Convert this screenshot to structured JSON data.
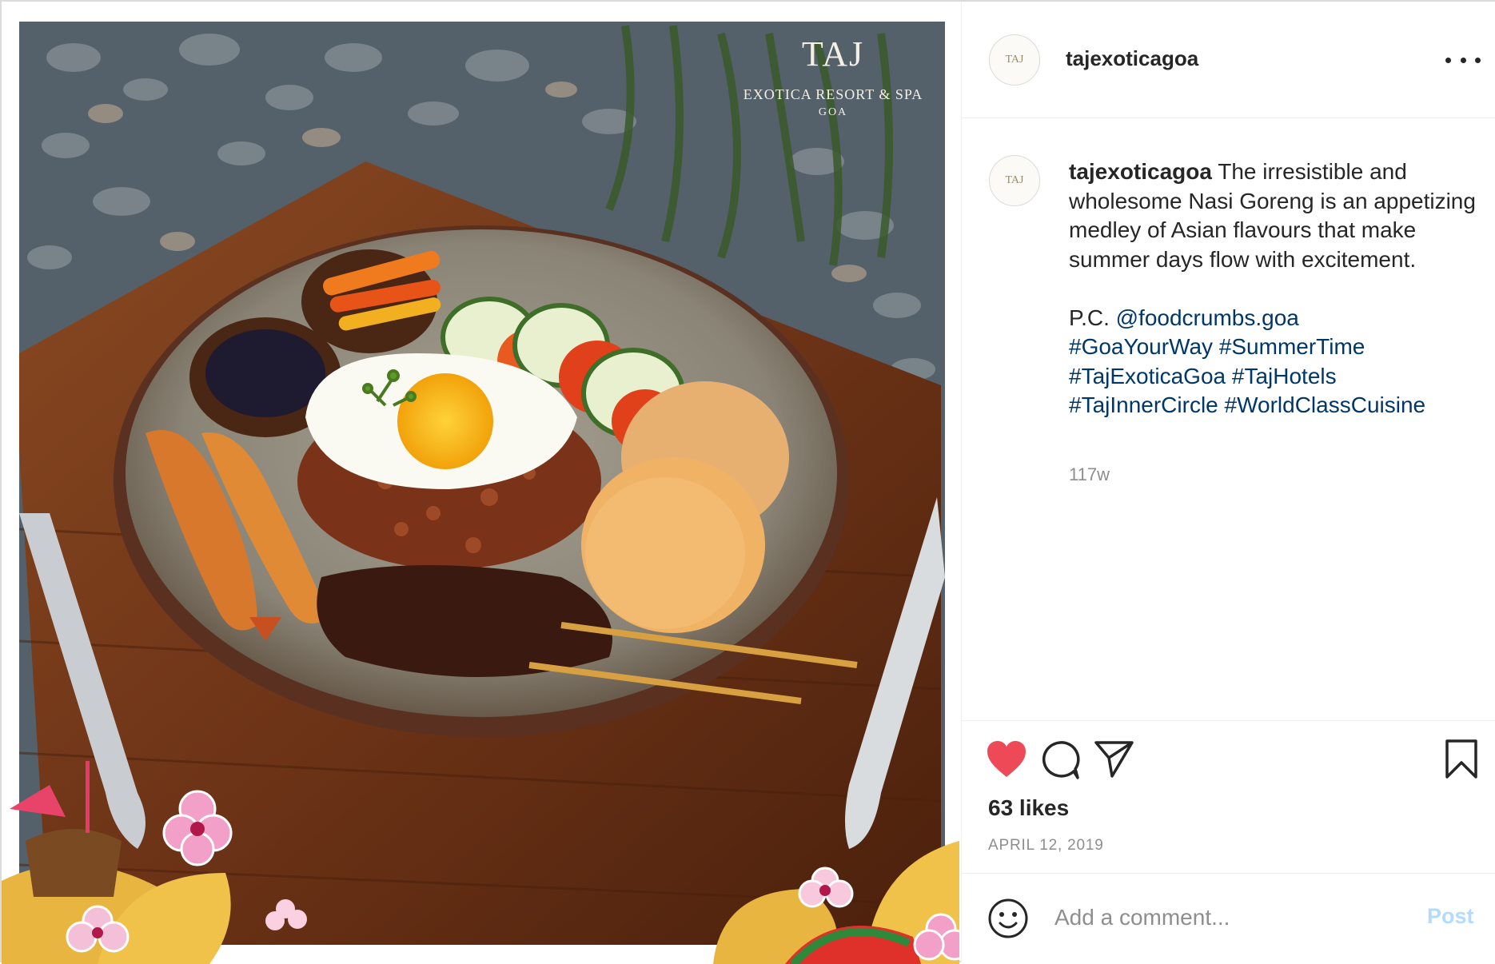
{
  "photo": {
    "logo_name": "TAJ",
    "logo_line": "EXOTICA RESORT & SPA",
    "logo_city": "GOA",
    "logo_alt": "Taj Exotica Resort & Spa Goa"
  },
  "header": {
    "username": "tajexoticagoa",
    "avatar_text": "TAJ"
  },
  "caption": {
    "username": "tajexoticagoa",
    "text": "The irresistible and wholesome Nasi Goreng is an appetizing medley of Asian flavours that make summer days flow with excitement.",
    "credit_prefix": "P.C. ",
    "mention": "@foodcrumbs.goa",
    "hashtags": [
      "#GoaYourWay",
      "#SummerTime",
      "#TajExoticaGoa",
      "#TajHotels",
      "#TajInnerCircle",
      "#WorldClassCuisine"
    ],
    "age": "117w"
  },
  "actions": {
    "likes": "63 likes",
    "date": "APRIL 12, 2019",
    "like_color": "#ed4956",
    "liked": true
  },
  "comment": {
    "placeholder": "Add a comment...",
    "post_label": "Post",
    "post_color": "#b3dbff"
  },
  "colors": {
    "text": "#262626",
    "muted": "#8e8e8e",
    "link": "#00376b",
    "border": "#dbdbdb"
  }
}
